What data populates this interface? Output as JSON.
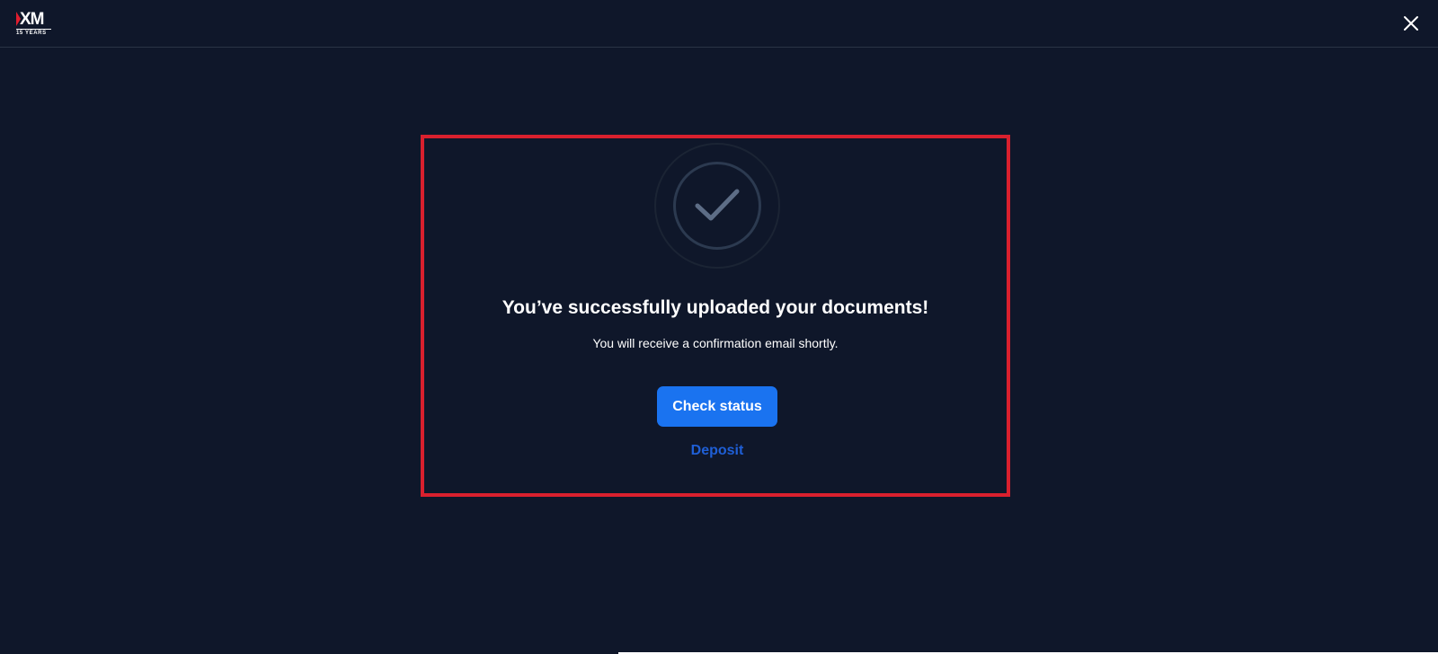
{
  "header": {
    "logo_mark": "XM",
    "logo_sub": "15 YEARS",
    "close_icon": "close-icon"
  },
  "main": {
    "status_icon": "checkmark-icon",
    "title": "You’ve successfully uploaded your documents!",
    "subtitle": "You will receive a confirmation email shortly.",
    "primary_button_label": "Check status",
    "secondary_link_label": "Deposit"
  },
  "colors": {
    "background": "#0f172a",
    "primary_button": "#1a73f0",
    "link": "#1f5fd6",
    "highlight_frame": "#d9202e",
    "logo_accent": "#e11d2e"
  }
}
